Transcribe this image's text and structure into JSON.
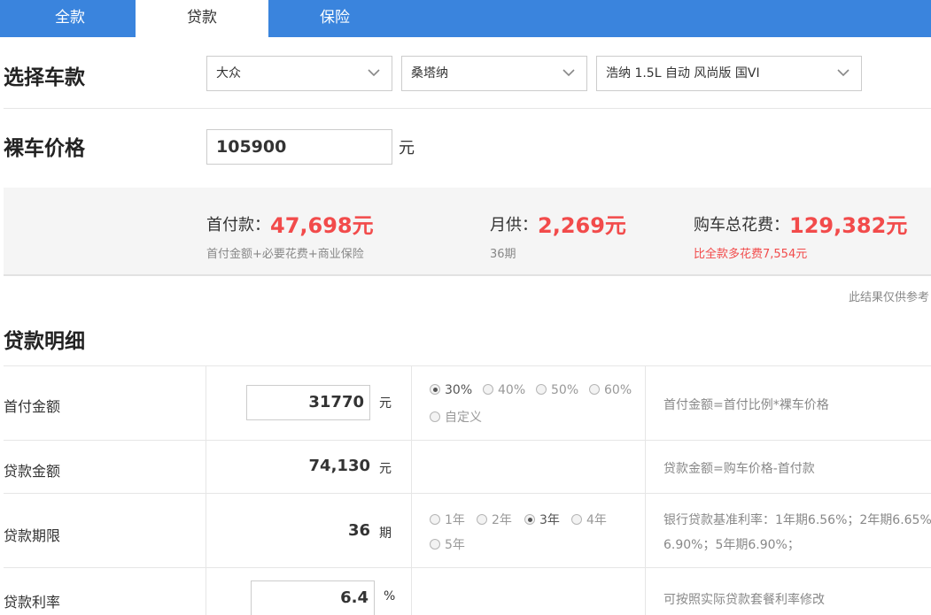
{
  "tabs": [
    {
      "label": "全款",
      "active": false
    },
    {
      "label": "贷款",
      "active": true
    },
    {
      "label": "保险",
      "active": false
    }
  ],
  "select_model": {
    "title": "选择车款",
    "brand": "大众",
    "series": "桑塔纳",
    "trim": "浩纳 1.5L 自动 风尚版 国VI"
  },
  "bare_price": {
    "title": "裸车价格",
    "value": "105900",
    "unit": "元"
  },
  "summary": {
    "down_payment": {
      "label": "首付款：",
      "value": "47,698元",
      "sub": "首付金额+必要花费+商业保险"
    },
    "monthly": {
      "label": "月供：",
      "value": "2,269元",
      "sub": "36期"
    },
    "total": {
      "label": "购车总花费：",
      "value": "129,382元",
      "sub": "比全款多花费7,554元"
    }
  },
  "disclaimer": "此结果仅供参考",
  "loan_detail": {
    "title": "贷款明细",
    "rows": {
      "down_payment": {
        "label": "首付金额",
        "value": "31770",
        "unit": "元",
        "options": [
          "30%",
          "40%",
          "50%",
          "60%",
          "自定义"
        ],
        "selected": "30%",
        "note": "首付金额=首付比例*裸车价格"
      },
      "loan_amount": {
        "label": "贷款金额",
        "value": "74,130",
        "unit": "元",
        "note": "贷款金额=购车价格-首付款"
      },
      "term": {
        "label": "贷款期限",
        "value": "36",
        "unit": "期",
        "options": [
          "1年",
          "2年",
          "3年",
          "4年",
          "5年"
        ],
        "selected": "3年",
        "note_line1": "银行贷款基准利率：1年期6.56%；2年期6.65%；",
        "note_line2": "6.90%；5年期6.90%；"
      },
      "rate": {
        "label": "贷款利率",
        "value": "6.4",
        "unit": "%",
        "note": "可按照实际贷款套餐利率修改"
      }
    }
  },
  "colors": {
    "tab_bar": "#3a84dd",
    "accent_red": "#f24b4b",
    "summary_bg": "#f5f5f5"
  }
}
